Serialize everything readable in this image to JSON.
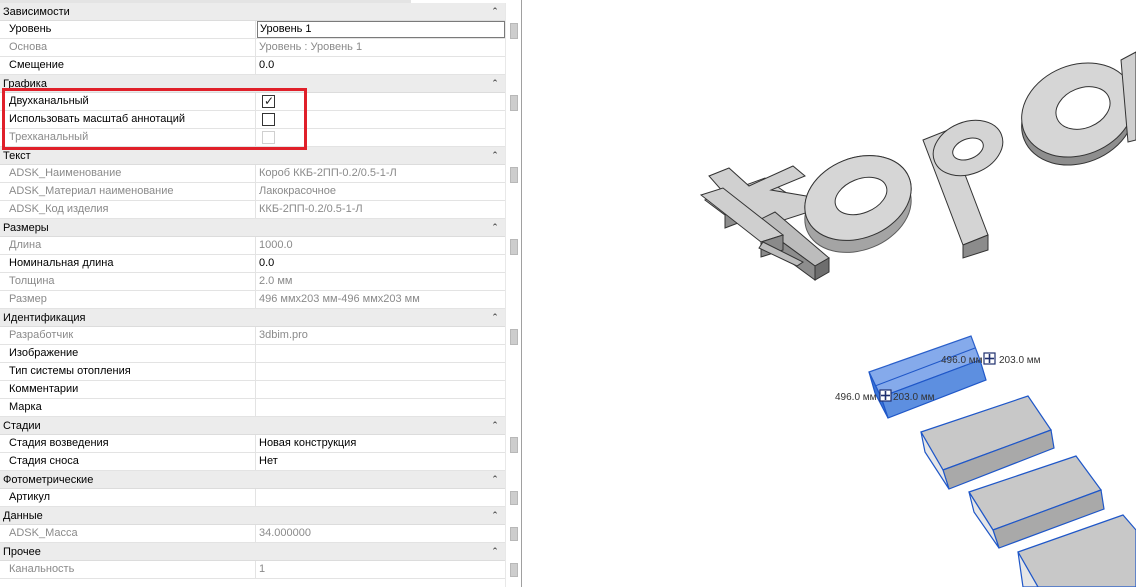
{
  "panel": {
    "groups": [
      {
        "title": "Зависимости",
        "rows": [
          {
            "name": "Уровень",
            "value": "Уровень 1",
            "readonly": false,
            "editing": true
          },
          {
            "name": "Основа",
            "value": "Уровень : Уровень 1",
            "readonly": true
          },
          {
            "name": "Смещение",
            "value": "0.0",
            "readonly": false
          }
        ]
      },
      {
        "title": "Графика",
        "rows": [
          {
            "name": "Двухканальный",
            "check": true,
            "readonly": false
          },
          {
            "name": "Использовать масштаб аннотаций",
            "check": false,
            "readonly": false
          },
          {
            "name": "Трехканальный",
            "check": false,
            "readonly": true
          }
        ]
      },
      {
        "title": "Текст",
        "rows": [
          {
            "name": "ADSK_Наименование",
            "value": "Короб ККБ-2ПП-0.2/0.5-1-Л",
            "readonly": true
          },
          {
            "name": "ADSK_Материал наименование",
            "value": "Лакокрасочное",
            "readonly": true
          },
          {
            "name": "ADSK_Код изделия",
            "value": "ККБ-2ПП-0.2/0.5-1-Л",
            "readonly": true
          }
        ]
      },
      {
        "title": "Размеры",
        "rows": [
          {
            "name": "Длина",
            "value": "1000.0",
            "readonly": true
          },
          {
            "name": "Номинальная длина",
            "value": "0.0",
            "readonly": false
          },
          {
            "name": "Толщина",
            "value": "2.0 мм",
            "readonly": true
          },
          {
            "name": "Размер",
            "value": "496 ммx203 мм-496 ммx203 мм",
            "readonly": true
          }
        ]
      },
      {
        "title": "Идентификация",
        "rows": [
          {
            "name": "Разработчик",
            "value": "3dbim.pro",
            "readonly": true
          },
          {
            "name": "Изображение",
            "value": "",
            "readonly": false
          },
          {
            "name": "Тип системы отопления",
            "value": "",
            "readonly": false
          },
          {
            "name": "Комментарии",
            "value": "",
            "readonly": false
          },
          {
            "name": "Марка",
            "value": "",
            "readonly": false
          }
        ]
      },
      {
        "title": "Стадии",
        "rows": [
          {
            "name": "Стадия возведения",
            "value": "Новая конструкция",
            "readonly": false
          },
          {
            "name": "Стадия сноса",
            "value": "Нет",
            "readonly": false
          }
        ]
      },
      {
        "title": "Фотометрические",
        "rows": [
          {
            "name": "Артикул",
            "value": "",
            "readonly": false
          }
        ]
      },
      {
        "title": "Данные",
        "rows": [
          {
            "name": "ADSK_Масса",
            "value": "34.000000",
            "readonly": true
          }
        ]
      },
      {
        "title": "Прочее",
        "rows": [
          {
            "name": "Канальность",
            "value": "1",
            "readonly": true
          }
        ]
      }
    ],
    "collapse_glyph": "⌃",
    "check_glyph": "✓",
    "highlight_color": "#e0202a"
  },
  "viewport": {
    "text_3d": "КОРО",
    "dim_labels": [
      "496.0 мм",
      "203.0 мм",
      "496.0 мм",
      "203.0 мм"
    ],
    "selection_color": "#4a86e8"
  }
}
